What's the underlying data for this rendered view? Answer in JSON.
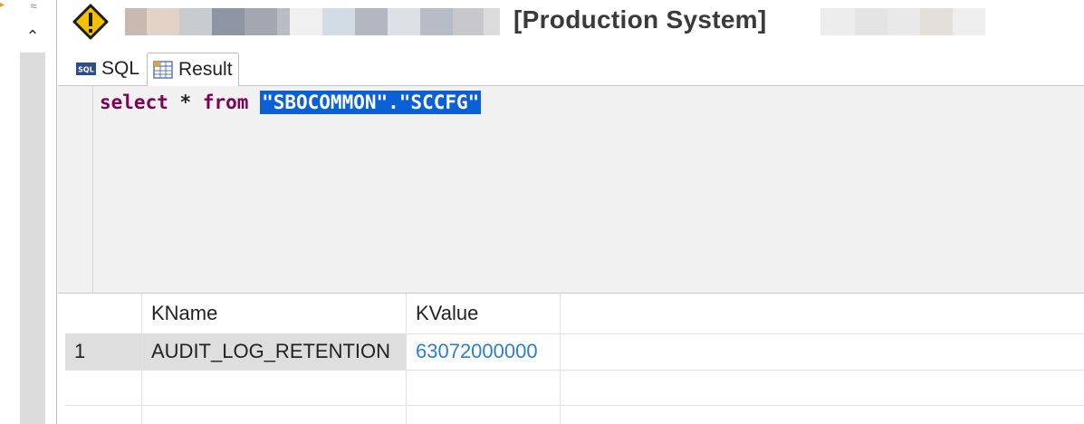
{
  "window": {
    "title": "[Production System]"
  },
  "tabs": [
    {
      "label": "SQL",
      "active": false
    },
    {
      "label": "Result",
      "active": true
    }
  ],
  "editor": {
    "keyword_select": "select",
    "star": "*",
    "keyword_from": "from",
    "selected_text": "\"SBOCOMMON\".\"SCCFG\""
  },
  "grid": {
    "columns": [
      "",
      "KName",
      "KValue"
    ],
    "rows": [
      {
        "index": "1",
        "kname": "AUDIT_LOG_RETENTION",
        "kvalue": "63072000000"
      }
    ]
  },
  "colors": {
    "keyword": "#7f0055",
    "selection": "#0b5fd7",
    "value_link": "#2a7fd4",
    "warning": "#f2c200"
  },
  "icons": [
    "warning-icon",
    "sql-tab-icon",
    "result-tab-icon",
    "chevron-up-icon"
  ]
}
